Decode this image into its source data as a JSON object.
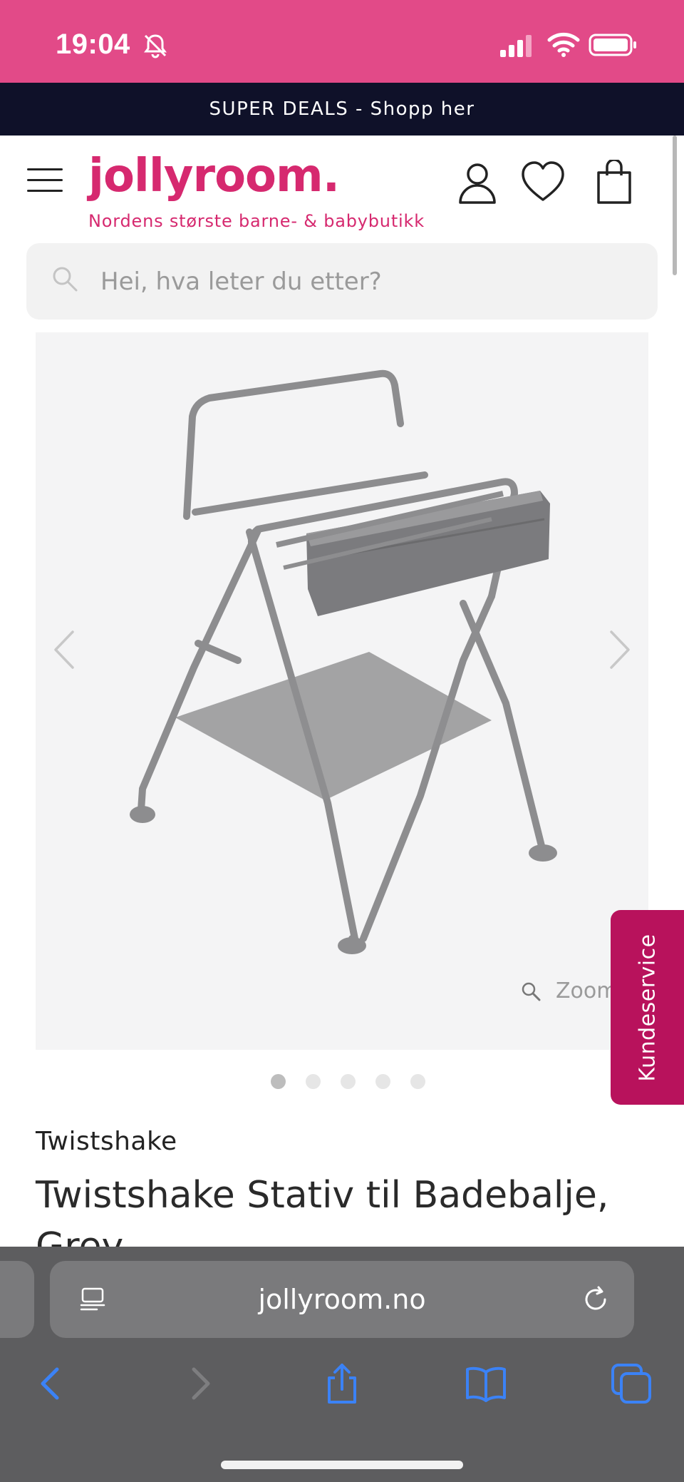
{
  "status_bar": {
    "time": "19:04",
    "icons": [
      "bell-slash-icon",
      "cellular-signal-icon",
      "wifi-icon",
      "battery-icon"
    ],
    "background": "#e24a88"
  },
  "promo": {
    "text": "SUPER DEALS - Shopp her"
  },
  "header": {
    "logo": "jollyroom.",
    "tagline": "Nordens største barne- & babybutikk",
    "icons": [
      "menu-icon",
      "user-icon",
      "heart-icon",
      "shopping-bag-icon"
    ],
    "brand_color": "#d6296f"
  },
  "search": {
    "placeholder": "Hei, hva leter du etter?"
  },
  "gallery": {
    "zoom_label": "Zoom",
    "image_count": 5,
    "active_index": 0
  },
  "customer_service": {
    "label": "Kundeservice",
    "color": "#b8125c"
  },
  "product": {
    "brand": "Twistshake",
    "title": "Twistshake Stativ til Badebalje, Grey"
  },
  "browser": {
    "url": "jollyroom.no",
    "icons": [
      "reader-icon",
      "reload-icon",
      "back-icon",
      "forward-icon",
      "share-icon",
      "bookmarks-icon",
      "tabs-icon"
    ],
    "accent": "#3b82f6"
  }
}
